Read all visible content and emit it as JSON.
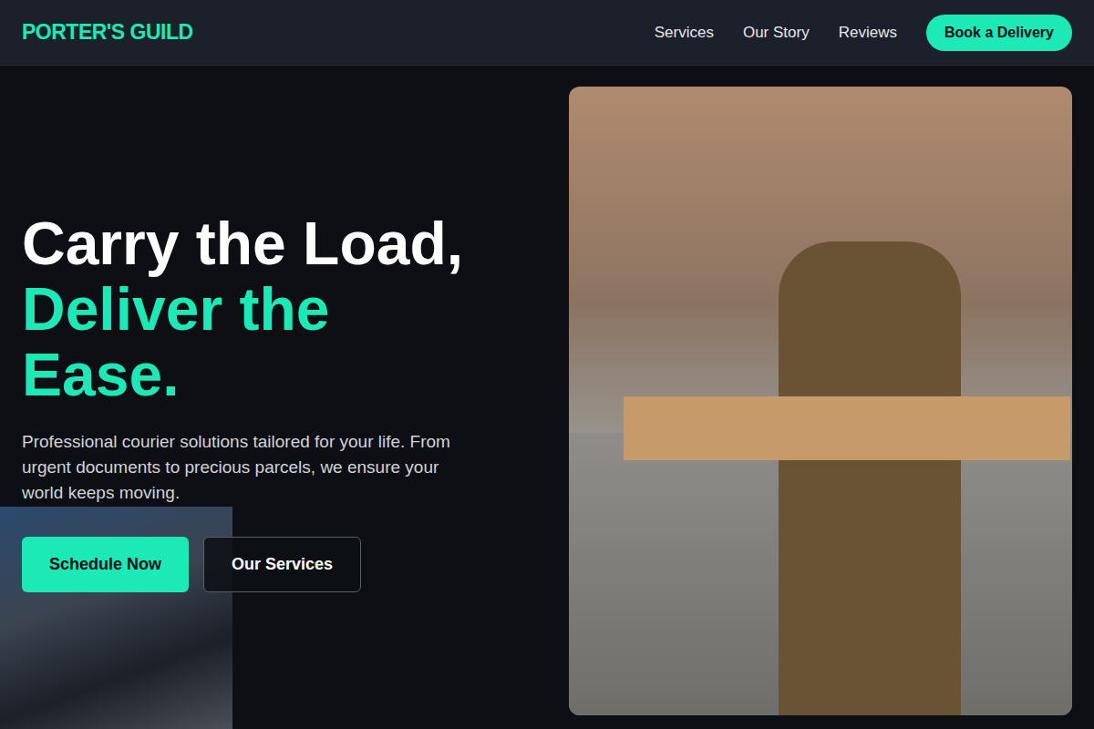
{
  "header": {
    "logo": "PORTER'S GUILD",
    "nav": [
      "Services",
      "Our Story",
      "Reviews"
    ],
    "cta": "Book a Delivery"
  },
  "hero": {
    "title_line1": "Carry the Load,",
    "title_line2": "Deliver the Ease.",
    "description": "Professional courier solutions tailored for your life. From urgent documents to precious parcels, we ensure your world keeps moving.",
    "buttons": [
      {
        "label": "Schedule Now",
        "kind": "primary"
      },
      {
        "label": "Our Services",
        "kind": "outline"
      }
    ]
  }
}
